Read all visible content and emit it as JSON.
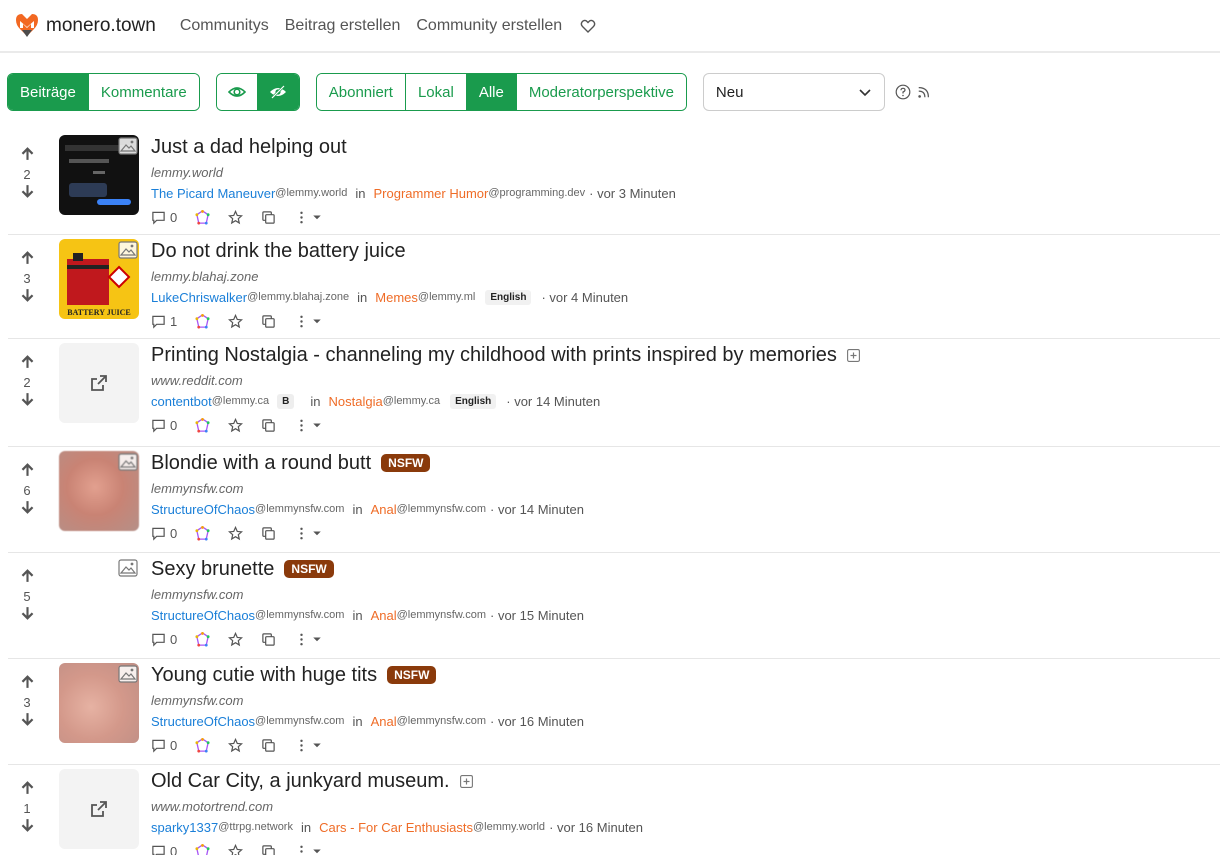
{
  "brand": {
    "name": "monero.town"
  },
  "nav": {
    "communities": "Communitys",
    "create_post": "Beitrag erstellen",
    "create_community": "Community erstellen"
  },
  "filters": {
    "type": [
      "Beiträge",
      "Kommentare"
    ],
    "listing": [
      "Abonniert",
      "Lokal",
      "Alle",
      "Moderatorperspektive"
    ],
    "sort": "Neu"
  },
  "labels": {
    "in": "in",
    "nsfw": "NSFW"
  },
  "posts": [
    {
      "score": "2",
      "title": "Just a dad helping out",
      "domain": "lemmy.world",
      "user": "The Picard Maneuver",
      "user_inst": "@lemmy.world",
      "community": "Programmer Humor",
      "comm_inst": "@programming.dev",
      "lang": "",
      "time": "· vor 3 Minuten",
      "comments": "0"
    },
    {
      "score": "3",
      "title": "Do not drink the battery juice",
      "domain": "lemmy.blahaj.zone",
      "user": "LukeChriswalker",
      "user_inst": "@lemmy.blahaj.zone",
      "community": "Memes",
      "comm_inst": "@lemmy.ml",
      "lang": "English",
      "time": "· vor 4 Minuten",
      "comments": "1",
      "thumb_text": "BATTERY JUICE"
    },
    {
      "score": "2",
      "title": "Printing Nostalgia - channeling my childhood with prints inspired by memories",
      "domain": "www.reddit.com",
      "user": "contentbot",
      "user_inst": "@lemmy.ca",
      "badge": "B",
      "community": "Nostalgia",
      "comm_inst": "@lemmy.ca",
      "lang": "English",
      "time": "· vor 14 Minuten",
      "comments": "0"
    },
    {
      "score": "6",
      "title": "Blondie with a round butt",
      "domain": "lemmynsfw.com",
      "user": "StructureOfChaos",
      "user_inst": "@lemmynsfw.com",
      "community": "Anal",
      "comm_inst": "@lemmynsfw.com",
      "lang": "",
      "time": "· vor 14 Minuten",
      "comments": "0"
    },
    {
      "score": "5",
      "title": "Sexy brunette",
      "domain": "lemmynsfw.com",
      "user": "StructureOfChaos",
      "user_inst": "@lemmynsfw.com",
      "community": "Anal",
      "comm_inst": "@lemmynsfw.com",
      "lang": "",
      "time": "· vor 15 Minuten",
      "comments": "0"
    },
    {
      "score": "3",
      "title": "Young cutie with huge tits",
      "domain": "lemmynsfw.com",
      "user": "StructureOfChaos",
      "user_inst": "@lemmynsfw.com",
      "community": "Anal",
      "comm_inst": "@lemmynsfw.com",
      "lang": "",
      "time": "· vor 16 Minuten",
      "comments": "0"
    },
    {
      "score": "1",
      "title": "Old Car City, a junkyard museum.",
      "domain": "www.motortrend.com",
      "user": "sparky1337",
      "user_inst": "@ttrpg.network",
      "community": "Cars - For Car Enthusiasts",
      "comm_inst": "@lemmy.world",
      "lang": "",
      "time": "· vor 16 Minuten",
      "comments": "0"
    }
  ],
  "colors": {
    "accent": "#1a9b4d",
    "user": "#1a7fd8",
    "community": "#ef6c27",
    "nsfw": "#8a3a0b"
  }
}
